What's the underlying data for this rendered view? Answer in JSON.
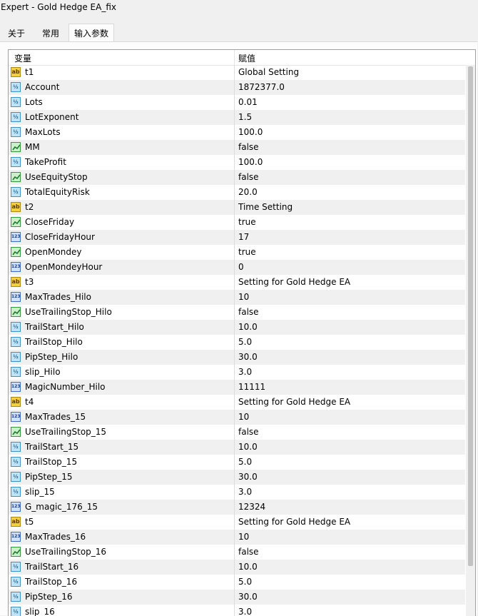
{
  "window": {
    "title": "Expert - Gold Hedge EA_fix"
  },
  "tabs": [
    {
      "label": "关于"
    },
    {
      "label": "常用"
    },
    {
      "label": "输入参数",
      "active": true
    }
  ],
  "table": {
    "headers": {
      "variable": "变量",
      "value": "赋值"
    },
    "rows": [
      {
        "type": "string",
        "name": "t1",
        "value": "Global Setting"
      },
      {
        "type": "double",
        "name": "Account",
        "value": "1872377.0"
      },
      {
        "type": "double",
        "name": "Lots",
        "value": "0.01"
      },
      {
        "type": "double",
        "name": "LotExponent",
        "value": "1.5"
      },
      {
        "type": "double",
        "name": "MaxLots",
        "value": "100.0"
      },
      {
        "type": "bool",
        "name": "MM",
        "value": "false"
      },
      {
        "type": "double",
        "name": "TakeProfit",
        "value": "100.0"
      },
      {
        "type": "bool",
        "name": "UseEquityStop",
        "value": "false"
      },
      {
        "type": "double",
        "name": "TotalEquityRisk",
        "value": "20.0"
      },
      {
        "type": "string",
        "name": "t2",
        "value": "Time Setting"
      },
      {
        "type": "bool",
        "name": "CloseFriday",
        "value": "true"
      },
      {
        "type": "int",
        "name": "CloseFridayHour",
        "value": "17"
      },
      {
        "type": "bool",
        "name": "OpenMondey",
        "value": "true"
      },
      {
        "type": "int",
        "name": "OpenMondeyHour",
        "value": "0"
      },
      {
        "type": "string",
        "name": "t3",
        "value": "Setting for Gold Hedge EA"
      },
      {
        "type": "int",
        "name": "MaxTrades_Hilo",
        "value": "10"
      },
      {
        "type": "bool",
        "name": "UseTrailingStop_Hilo",
        "value": "false"
      },
      {
        "type": "double",
        "name": "TrailStart_Hilo",
        "value": "10.0"
      },
      {
        "type": "double",
        "name": "TrailStop_Hilo",
        "value": "5.0"
      },
      {
        "type": "double",
        "name": "PipStep_Hilo",
        "value": "30.0"
      },
      {
        "type": "double",
        "name": "slip_Hilo",
        "value": "3.0"
      },
      {
        "type": "int",
        "name": "MagicNumber_Hilo",
        "value": "11111"
      },
      {
        "type": "string",
        "name": "t4",
        "value": "Setting for Gold Hedge EA"
      },
      {
        "type": "int",
        "name": "MaxTrades_15",
        "value": "10"
      },
      {
        "type": "bool",
        "name": "UseTrailingStop_15",
        "value": "false"
      },
      {
        "type": "double",
        "name": "TrailStart_15",
        "value": "10.0"
      },
      {
        "type": "double",
        "name": "TrailStop_15",
        "value": "5.0"
      },
      {
        "type": "double",
        "name": "PipStep_15",
        "value": "30.0"
      },
      {
        "type": "double",
        "name": "slip_15",
        "value": "3.0"
      },
      {
        "type": "int",
        "name": "G_magic_176_15",
        "value": "12324"
      },
      {
        "type": "string",
        "name": "t5",
        "value": "Setting for Gold Hedge EA"
      },
      {
        "type": "int",
        "name": "MaxTrades_16",
        "value": "10"
      },
      {
        "type": "bool",
        "name": "UseTrailingStop_16",
        "value": "false"
      },
      {
        "type": "double",
        "name": "TrailStart_16",
        "value": "10.0"
      },
      {
        "type": "double",
        "name": "TrailStop_16",
        "value": "5.0"
      },
      {
        "type": "double",
        "name": "PipStep_16",
        "value": "30.0"
      },
      {
        "type": "double",
        "name": "slip_16",
        "value": "3.0"
      }
    ]
  },
  "icons": {
    "string": {
      "name": "string-type-icon",
      "glyph": "ab"
    },
    "double": {
      "name": "double-type-icon",
      "glyph": "½"
    },
    "int": {
      "name": "integer-type-icon",
      "glyph": "123"
    },
    "bool": {
      "name": "boolean-type-icon",
      "glyph": ""
    }
  },
  "colors": {
    "row_alt": "#f0f0f0",
    "header_bg": "#ffffff",
    "border": "#a0a0a0"
  }
}
